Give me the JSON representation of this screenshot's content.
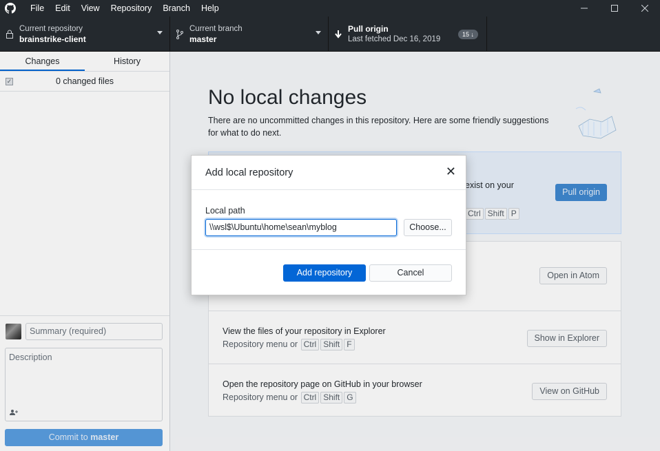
{
  "menubar": {
    "items": [
      "File",
      "Edit",
      "View",
      "Repository",
      "Branch",
      "Help"
    ]
  },
  "toolbar": {
    "repo_label": "Current repository",
    "repo_value": "brainstrike-client",
    "branch_label": "Current branch",
    "branch_value": "master",
    "pull_label": "Pull origin",
    "pull_sub": "Last fetched Dec 16, 2019",
    "pull_badge": "15"
  },
  "sidebar": {
    "tabs": [
      "Changes",
      "History"
    ],
    "changes_count": "0 changed files",
    "summary_placeholder": "Summary (required)",
    "description_placeholder": "Description",
    "commit_prefix": "Commit to ",
    "commit_branch": "master"
  },
  "main": {
    "title": "No local changes",
    "subtitle": "There are no uncommitted changes in this repository. Here are some friendly suggestions for what to do next.",
    "blue_card_text": "exist on your",
    "blue_card_keys": [
      "Ctrl",
      "Shift",
      "P"
    ],
    "pull_button": "Pull origin",
    "atom_button": "Open in Atom",
    "explorer": {
      "title": "View the files of your repository in Explorer",
      "sub": "Repository menu or",
      "keys": [
        "Ctrl",
        "Shift",
        "F"
      ],
      "button": "Show in Explorer"
    },
    "github": {
      "title": "Open the repository page on GitHub in your browser",
      "sub": "Repository menu or",
      "keys": [
        "Ctrl",
        "Shift",
        "G"
      ],
      "button": "View on GitHub"
    }
  },
  "dialog": {
    "title": "Add local repository",
    "path_label": "Local path",
    "path_value": "\\\\wsl$\\Ubuntu\\home\\sean\\myblog",
    "choose_button": "Choose...",
    "add_button": "Add repository",
    "cancel_button": "Cancel"
  }
}
